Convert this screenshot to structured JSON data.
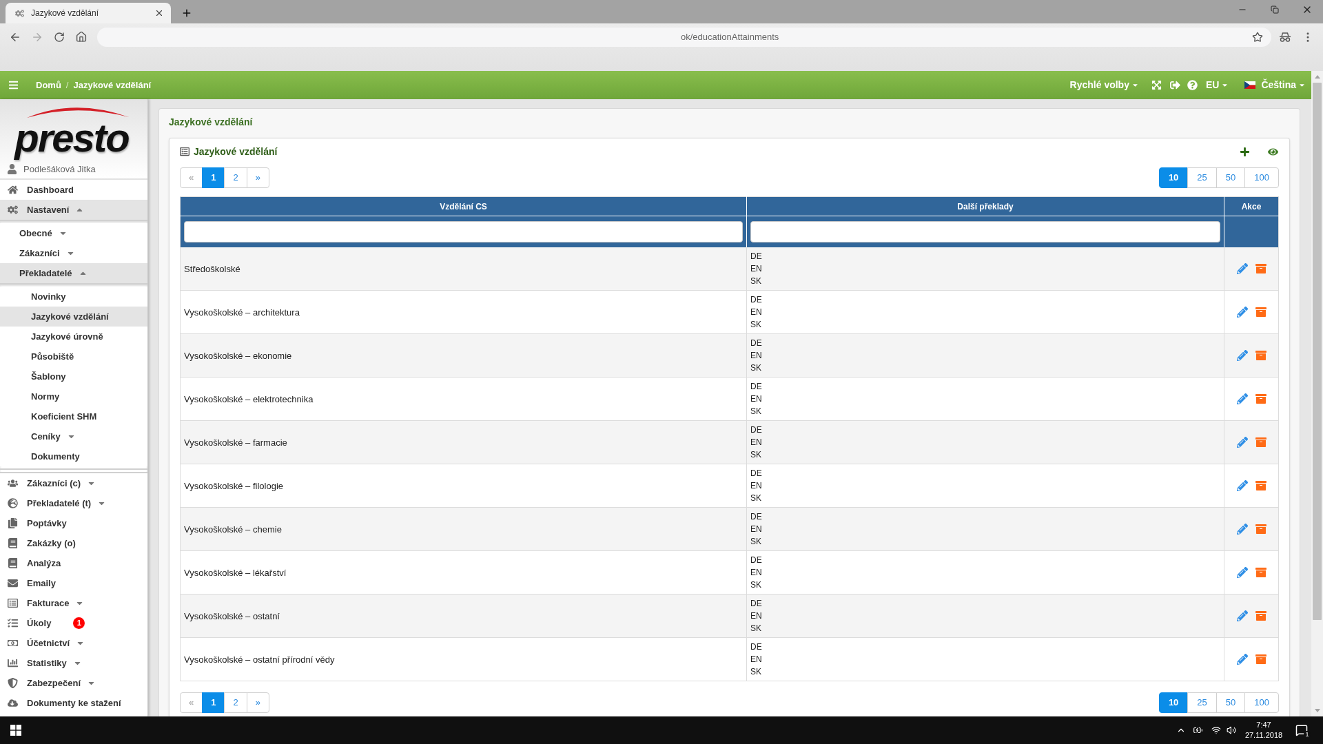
{
  "browser": {
    "tab_title": "Jazykové vzdělání",
    "address": "ok/educationAttainments"
  },
  "header": {
    "breadcrumb": [
      "Domů",
      "Jazykové vzdělání"
    ],
    "separator": "/",
    "quick_options": "Rychlé volby",
    "region": "EU",
    "language": "Čeština"
  },
  "sidebar": {
    "logo": "presto",
    "user": "Podlešáková Jitka",
    "items": [
      {
        "label": "Dashboard",
        "kind": "link",
        "selected": false
      },
      {
        "label": "Nastavení",
        "kind": "group",
        "selected": true,
        "expanded": true,
        "children": [
          {
            "label": "Obecné",
            "kind": "group",
            "selected": false,
            "expanded": false
          },
          {
            "label": "Zákazníci",
            "kind": "group",
            "selected": false,
            "expanded": false
          },
          {
            "label": "Překladatelé",
            "kind": "group",
            "selected": true,
            "expanded": true,
            "children": [
              {
                "label": "Novinky",
                "kind": "link",
                "selected": false
              },
              {
                "label": "Jazykové vzdělání",
                "kind": "link",
                "selected": true
              },
              {
                "label": "Jazykové úrovně",
                "kind": "link",
                "selected": false
              },
              {
                "label": "Působiště",
                "kind": "link",
                "selected": false
              },
              {
                "label": "Šablony",
                "kind": "link",
                "selected": false
              },
              {
                "label": "Normy",
                "kind": "link",
                "selected": false
              },
              {
                "label": "Koeficient SHM",
                "kind": "link",
                "selected": false
              },
              {
                "label": "Ceníky",
                "kind": "group",
                "selected": false,
                "expanded": false
              },
              {
                "label": "Dokumenty",
                "kind": "link",
                "selected": false
              }
            ]
          }
        ]
      },
      {
        "label": "Zákazníci (c)",
        "kind": "group",
        "selected": false,
        "expanded": false
      },
      {
        "label": "Překladatelé (t)",
        "kind": "group",
        "selected": false,
        "expanded": false
      },
      {
        "label": "Poptávky",
        "kind": "link",
        "selected": false
      },
      {
        "label": "Zakázky (o)",
        "kind": "link",
        "selected": false
      },
      {
        "label": "Analýza",
        "kind": "link",
        "selected": false
      },
      {
        "label": "Emaily",
        "kind": "link",
        "selected": false
      },
      {
        "label": "Fakturace",
        "kind": "group",
        "selected": false,
        "expanded": false
      },
      {
        "label": "Úkoly",
        "kind": "link",
        "selected": false,
        "badge": "1"
      },
      {
        "label": "Účetnictví",
        "kind": "group",
        "selected": false,
        "expanded": false
      },
      {
        "label": "Statistiky",
        "kind": "group",
        "selected": false,
        "expanded": false
      },
      {
        "label": "Zabezpečení",
        "kind": "group",
        "selected": false,
        "expanded": false
      },
      {
        "label": "Dokumenty ke stažení",
        "kind": "link",
        "selected": false
      }
    ]
  },
  "page": {
    "title": "Jazykové vzdělání"
  },
  "card": {
    "title": "Jazykové vzdělání",
    "pagination": [
      {
        "label": "«",
        "selected": false,
        "disabled": true
      },
      {
        "label": "1",
        "selected": true,
        "disabled": false
      },
      {
        "label": "2",
        "selected": false,
        "disabled": false
      },
      {
        "label": "»",
        "selected": false,
        "disabled": false
      }
    ],
    "page_sizes": [
      {
        "label": "10",
        "selected": true
      },
      {
        "label": "25",
        "selected": false
      },
      {
        "label": "50",
        "selected": false
      },
      {
        "label": "100",
        "selected": false
      }
    ],
    "table": {
      "columns": [
        {
          "label": "Vzdělání CS",
          "filterable": true
        },
        {
          "label": "Další překlady",
          "filterable": true
        },
        {
          "label": "Akce",
          "filterable": false
        }
      ],
      "rows": [
        {
          "name": "Středoškolské",
          "translations": [
            "DE",
            "EN",
            "SK"
          ]
        },
        {
          "name": "Vysokoškolské – architektura",
          "translations": [
            "DE",
            "EN",
            "SK"
          ]
        },
        {
          "name": "Vysokoškolské – ekonomie",
          "translations": [
            "DE",
            "EN",
            "SK"
          ]
        },
        {
          "name": "Vysokoškolské – elektrotechnika",
          "translations": [
            "DE",
            "EN",
            "SK"
          ]
        },
        {
          "name": "Vysokoškolské – farmacie",
          "translations": [
            "DE",
            "EN",
            "SK"
          ]
        },
        {
          "name": "Vysokoškolské – filologie",
          "translations": [
            "DE",
            "EN",
            "SK"
          ]
        },
        {
          "name": "Vysokoškolské – chemie",
          "translations": [
            "DE",
            "EN",
            "SK"
          ]
        },
        {
          "name": "Vysokoškolské – lékařství",
          "translations": [
            "DE",
            "EN",
            "SK"
          ]
        },
        {
          "name": "Vysokoškolské – ostatní",
          "translations": [
            "DE",
            "EN",
            "SK"
          ]
        },
        {
          "name": "Vysokoškolské – ostatní přírodní vědy",
          "translations": [
            "DE",
            "EN",
            "SK"
          ]
        }
      ]
    },
    "bottom_pagination": [
      {
        "label": "«",
        "selected": false,
        "disabled": true
      },
      {
        "label": "1",
        "selected": true,
        "disabled": false
      },
      {
        "label": "2",
        "selected": false,
        "disabled": false
      },
      {
        "label": "»",
        "selected": false,
        "disabled": false
      }
    ],
    "bottom_page_sizes": [
      {
        "label": "10",
        "selected": true
      },
      {
        "label": "25",
        "selected": false
      },
      {
        "label": "50",
        "selected": false
      },
      {
        "label": "100",
        "selected": false
      }
    ]
  },
  "taskbar": {
    "time": "7:47",
    "date": "27.11.2018",
    "notifications": "1"
  }
}
